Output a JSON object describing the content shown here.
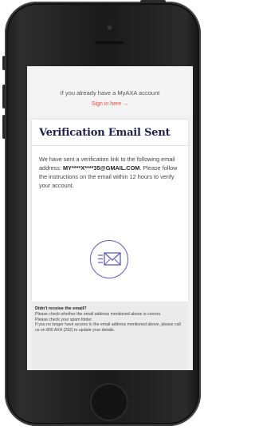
{
  "account_prompt": {
    "text": "If you already have a MyAXA account",
    "signin_label": "Sign in here",
    "signin_arrow": "→"
  },
  "card": {
    "title": "Verification Email Sent",
    "text_prefix": "We have sent a verification link to the following email address: ",
    "email": "MY****X****35@GMAIL.COM",
    "text_suffix": ". Please follow the instructions on the email within 12 hours to verify your account.",
    "icon": "mail-icon"
  },
  "help": {
    "title": "Didn't receive the email?",
    "lines": [
      "Please check whether the email address mentioned above is correct.",
      "Please check your spam folder.",
      "If you no longer have access to the email address mentioned above, please call us on 800 AXA (292) to update your details."
    ]
  },
  "colors": {
    "accent": "#e8453c",
    "title": "#20224a",
    "icon": "#5c5fb0"
  }
}
